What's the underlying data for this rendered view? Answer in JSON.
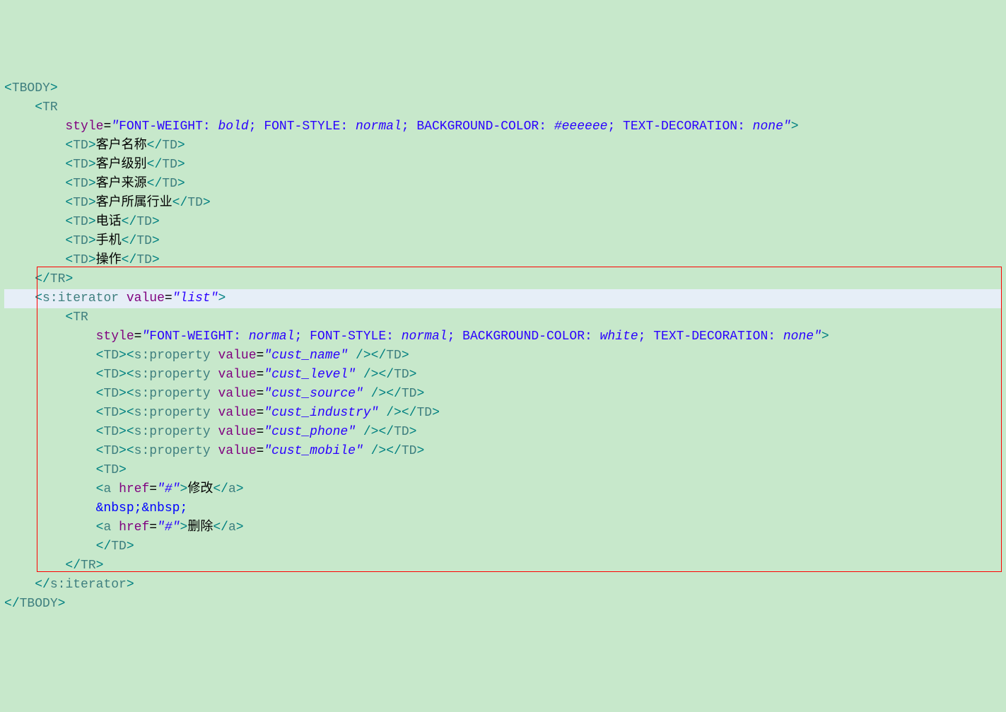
{
  "lines": {
    "l1": {
      "tag": "TBODY"
    },
    "l2": {
      "tag": "TR"
    },
    "l3": {
      "attr": "style",
      "vals": [
        "FONT-WEIGHT: ",
        "bold",
        "; FONT-STYLE: ",
        "normal",
        "; BACKGROUND-COLOR: ",
        "#eeeeee",
        "; TEXT-DECORATION: ",
        "none"
      ]
    },
    "l4": {
      "open": "TD",
      "text": "客户名称",
      "close": "TD"
    },
    "l5": {
      "open": "TD",
      "text": "客户级别",
      "close": "TD"
    },
    "l6": {
      "open": "TD",
      "text": "客户来源",
      "close": "TD"
    },
    "l7": {
      "open": "TD",
      "text": "客户所属行业",
      "close": "TD"
    },
    "l8": {
      "open": "TD",
      "text": "电话",
      "close": "TD"
    },
    "l9": {
      "open": "TD",
      "text": "手机",
      "close": "TD"
    },
    "l10": {
      "open": "TD",
      "text": "操作",
      "close": "TD"
    },
    "l11": {
      "closeTag": "TR"
    },
    "l12": {
      "tag": "s:iterator",
      "attr": "value",
      "val": "list"
    },
    "l13": {
      "tag": "TR"
    },
    "l14": {
      "attr": "style",
      "vals": [
        "FONT-WEIGHT: ",
        "normal",
        "; FONT-STYLE: ",
        "normal",
        "; BACKGROUND-COLOR: ",
        "white",
        "; TEXT-DECORATION: ",
        "none"
      ]
    },
    "l15": {
      "open": "TD",
      "ptag": "s:property",
      "pattr": "value",
      "pval": "cust_name",
      "close": "TD"
    },
    "l16": {
      "open": "TD",
      "ptag": "s:property",
      "pattr": "value",
      "pval": "cust_level",
      "close": "TD"
    },
    "l17": {
      "open": "TD",
      "ptag": "s:property",
      "pattr": "value",
      "pval": "cust_source",
      "close": "TD"
    },
    "l18": {
      "open": "TD",
      "ptag": "s:property",
      "pattr": "value",
      "pval": "cust_industry",
      "close": "TD"
    },
    "l19": {
      "open": "TD",
      "ptag": "s:property",
      "pattr": "value",
      "pval": "cust_phone",
      "close": "TD"
    },
    "l20": {
      "open": "TD",
      "ptag": "s:property",
      "pattr": "value",
      "pval": "cust_mobile",
      "close": "TD"
    },
    "l21": {
      "open": "TD"
    },
    "l22": {
      "atag": "a",
      "aattr": "href",
      "aval": "#",
      "atext": "修改"
    },
    "l23": {
      "nbsp": "&nbsp;&nbsp;"
    },
    "l24": {
      "atag": "a",
      "aattr": "href",
      "aval": "#",
      "atext": "删除"
    },
    "l25": {
      "closeTag": "TD"
    },
    "l26": {
      "closeTag": "TR"
    },
    "l27": {
      "closeTag": "s:iterator"
    },
    "l28": {
      "closeTag": "TBODY"
    }
  },
  "chars": {
    "lt": "<",
    "gt": ">",
    "slash": "/",
    "eq": "=",
    "quot": "\"",
    "sp": " ",
    "nbsp1": "&nbsp;",
    "nbsp2": "&nbsp;"
  }
}
